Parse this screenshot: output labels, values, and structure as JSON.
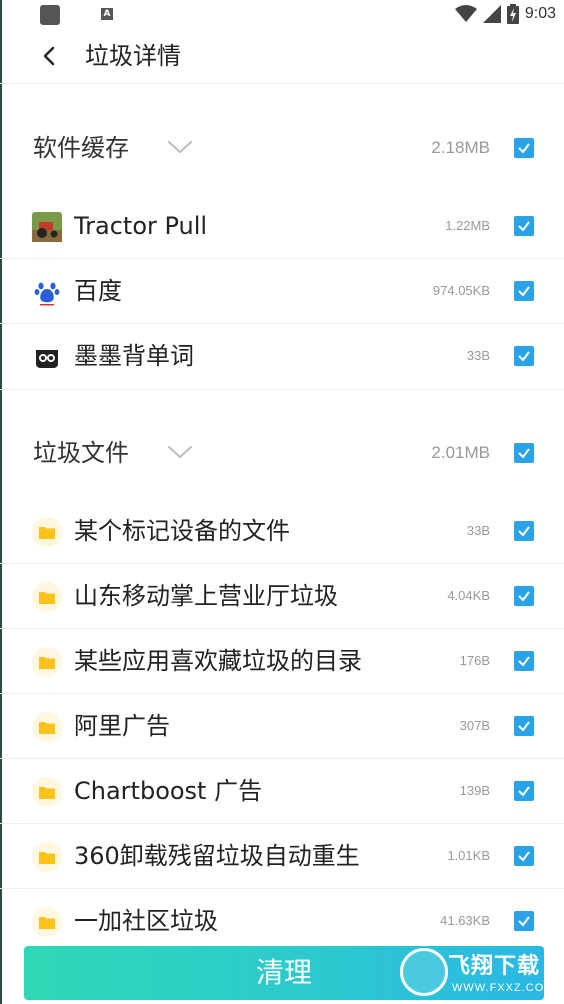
{
  "status_bar": {
    "time": "9:03",
    "left_icons": [
      "square-icon",
      "a-icon"
    ],
    "a_icon_letter": "A",
    "right_icons": [
      "wifi-icon",
      "signal-icon",
      "battery-charging-icon"
    ]
  },
  "header": {
    "title": "垃圾详情",
    "back_icon": "chevron-left-icon"
  },
  "sections": [
    {
      "title": "软件缓存",
      "size": "2.18MB",
      "checked": true,
      "items": [
        {
          "label": "Tractor Pull",
          "size": "1.22MB",
          "icon": "tractor-app-icon",
          "checked": true
        },
        {
          "label": "百度",
          "size": "974.05KB",
          "icon": "baidu-app-icon",
          "checked": true
        },
        {
          "label": "墨墨背单词",
          "size": "33B",
          "icon": "momo-app-icon",
          "checked": true
        }
      ]
    },
    {
      "title": "垃圾文件",
      "size": "2.01MB",
      "checked": true,
      "items": [
        {
          "label": "某个标记设备的文件",
          "size": "33B",
          "icon": "folder-icon",
          "checked": true
        },
        {
          "label": "山东移动掌上营业厅垃圾",
          "size": "4.04KB",
          "icon": "folder-icon",
          "checked": true
        },
        {
          "label": "某些应用喜欢藏垃圾的目录",
          "size": "176B",
          "icon": "folder-icon",
          "checked": true
        },
        {
          "label": "阿里广告",
          "size": "307B",
          "icon": "folder-icon",
          "checked": true
        },
        {
          "label": "Chartboost 广告",
          "size": "139B",
          "icon": "folder-icon",
          "checked": true
        },
        {
          "label": "360卸载残留垃圾自动重生",
          "size": "1.01KB",
          "icon": "folder-icon",
          "checked": true
        },
        {
          "label": "一加社区垃圾",
          "size": "41.63KB",
          "icon": "folder-icon",
          "checked": true
        }
      ]
    }
  ],
  "clean_button": {
    "label": "清理"
  },
  "watermark": {
    "title": "飞翔下载",
    "url": "WWW.FXXZ.COM"
  },
  "colors": {
    "accent": "#29a2e8",
    "folder": "#ffc21a",
    "button_start": "#2fd8b5",
    "button_end": "#2ab7e6"
  }
}
